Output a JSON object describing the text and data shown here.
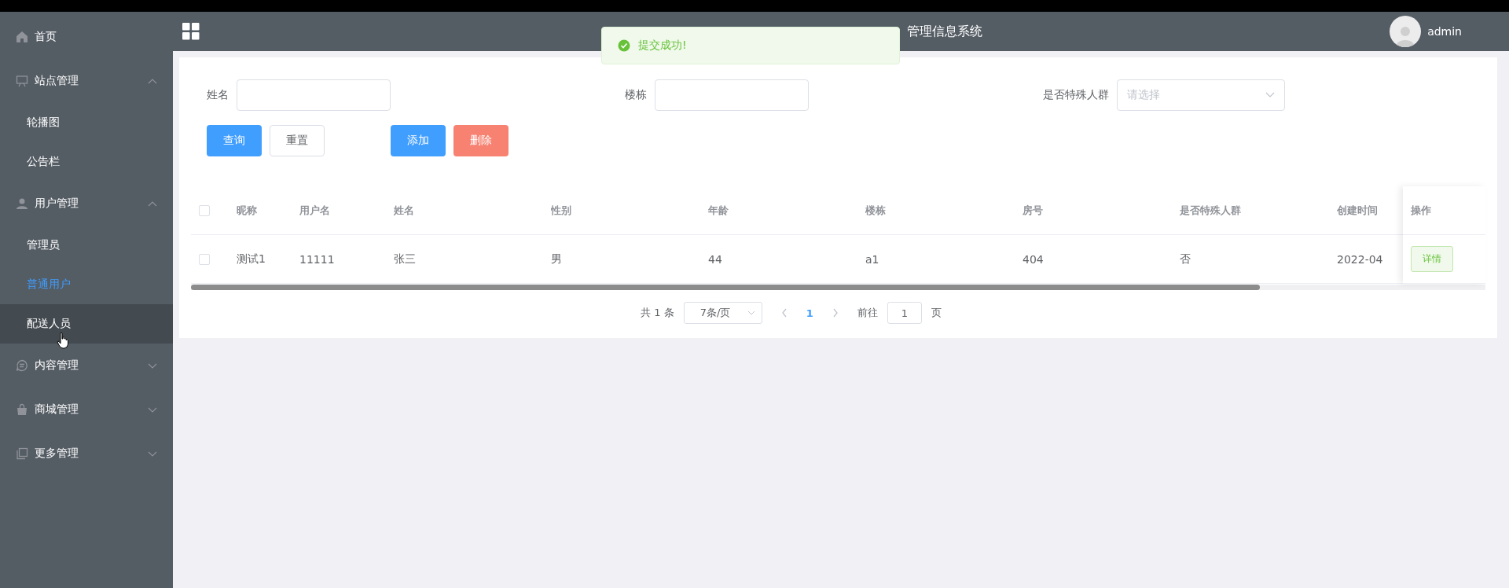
{
  "sidebar": {
    "items": [
      {
        "label": "首页"
      },
      {
        "label": "站点管理",
        "expanded": true,
        "children": [
          {
            "label": "轮播图",
            "selected": false,
            "hovered": false
          },
          {
            "label": "公告栏",
            "selected": false,
            "hovered": false
          }
        ]
      },
      {
        "label": "用户管理",
        "expanded": true,
        "children": [
          {
            "label": "管理员",
            "selected": false,
            "hovered": false
          },
          {
            "label": "普通用户",
            "selected": true,
            "hovered": false
          },
          {
            "label": "配送人员",
            "selected": false,
            "hovered": true
          }
        ]
      },
      {
        "label": "内容管理",
        "expanded": false
      },
      {
        "label": "商城管理",
        "expanded": false
      },
      {
        "label": "更多管理",
        "expanded": false
      }
    ]
  },
  "header": {
    "title": "管理信息系统",
    "user": "admin"
  },
  "toast": {
    "message": "提交成功!"
  },
  "search": {
    "fields": [
      {
        "label": "姓名",
        "kind": "input"
      },
      {
        "label": "楼栋",
        "kind": "input"
      },
      {
        "label": "是否特殊人群",
        "kind": "select",
        "placeholder": "请选择"
      }
    ],
    "buttons": [
      {
        "label": "查询",
        "kind": "primary"
      },
      {
        "label": "重置",
        "kind": "plain"
      },
      {
        "label": "添加",
        "kind": "primary"
      },
      {
        "label": "删除",
        "kind": "danger"
      }
    ]
  },
  "table": {
    "select_all_checked": false,
    "columns": [
      "昵称",
      "用户名",
      "姓名",
      "性别",
      "年龄",
      "楼栋",
      "房号",
      "是否特殊人群",
      "创建时间"
    ],
    "action_column": "操作",
    "rows": [
      {
        "checked": false,
        "cells": [
          "测试1",
          "11111",
          "张三",
          "男",
          "44",
          "a1",
          "404",
          "否",
          "2022-04"
        ],
        "action": "详情"
      }
    ]
  },
  "pagination": {
    "total": "共 1 条",
    "page_size": "7条/页",
    "pages": [
      {
        "label": "1",
        "selected": true
      }
    ],
    "goto_label": "前往",
    "goto_value": "1",
    "goto_suffix": "页"
  }
}
